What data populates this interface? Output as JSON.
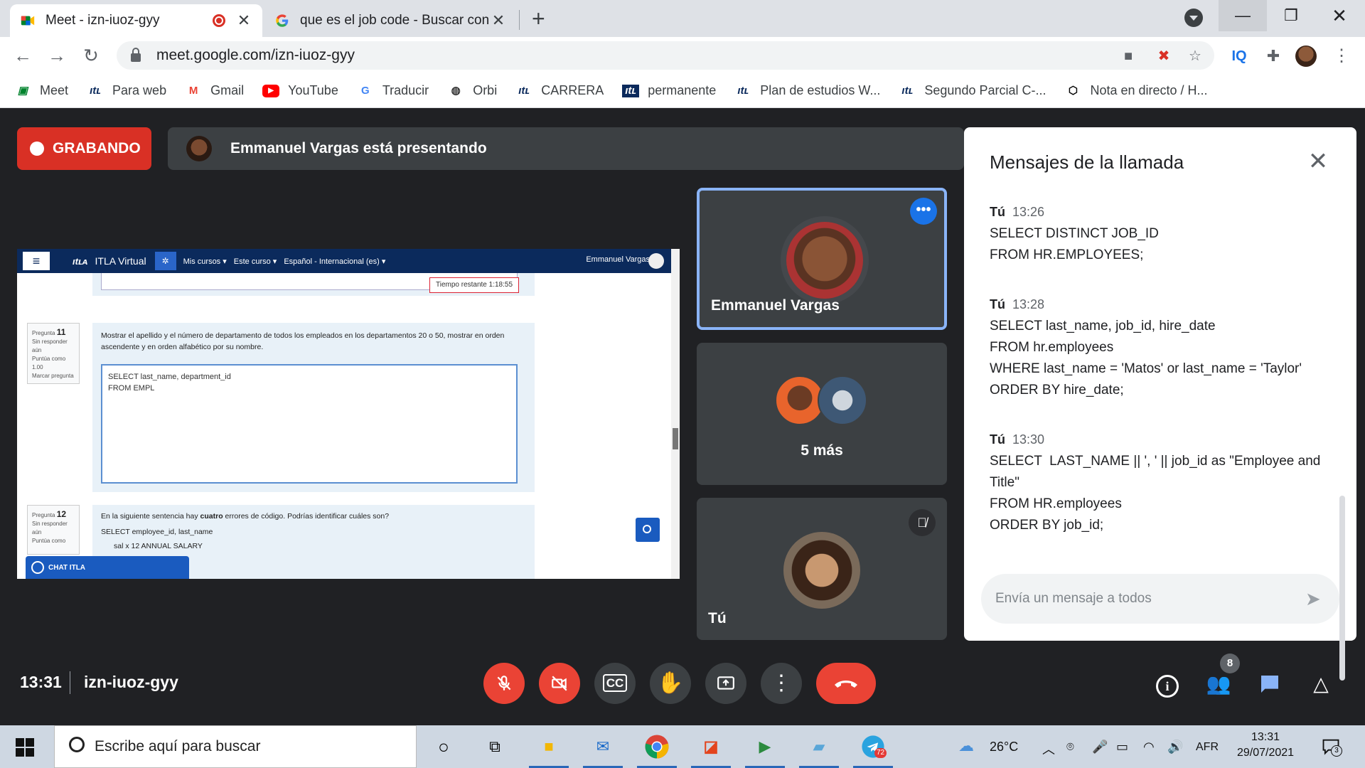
{
  "browser": {
    "tabs": [
      {
        "title": "Meet - izn-iuoz-gyy",
        "active": true
      },
      {
        "title": "que es el job code - Buscar con Google",
        "active": false
      }
    ],
    "url": "meet.google.com/izn-iuoz-gyy",
    "bookmarks": [
      {
        "label": "Meet",
        "icon": "meet-icon"
      },
      {
        "label": "Para web",
        "icon": "itla-icon"
      },
      {
        "label": "Gmail",
        "icon": "gmail-icon"
      },
      {
        "label": "YouTube",
        "icon": "youtube-icon"
      },
      {
        "label": "Traducir",
        "icon": "translate-icon"
      },
      {
        "label": "Orbi",
        "icon": "orbi-icon"
      },
      {
        "label": "CARRERA",
        "icon": "itla-icon"
      },
      {
        "label": "permanente",
        "icon": "itla-icon"
      },
      {
        "label": "Plan de estudios W...",
        "icon": "itla-icon"
      },
      {
        "label": "Segundo Parcial C-...",
        "icon": "itla-icon"
      },
      {
        "label": "Nota en directo / H...",
        "icon": "codepen-icon"
      }
    ]
  },
  "meet": {
    "recording_label": "GRABANDO",
    "presenting_text": "Emmanuel Vargas está presentando",
    "clock": "13:31",
    "meeting_code": "izn-iuoz-gyy",
    "participants_count": "8",
    "tiles": [
      {
        "name": "Emmanuel Vargas"
      },
      {
        "name": "5 más"
      },
      {
        "name": "Tú"
      }
    ]
  },
  "shared_screen": {
    "site_name": "ITLA Virtual",
    "nav": [
      "Mis cursos ▾",
      "Este curso ▾",
      "Español - Internacional (es) ▾"
    ],
    "user": "Emmanuel Vargas",
    "timer": "Tiempo restante 1:18:55",
    "q11": {
      "label": "Pregunta",
      "number": "11",
      "status": "Sin responder aún",
      "score": "Puntúa como 1.00",
      "flag": "Marcar pregunta",
      "text": "Mostrar el apellido y el número de departamento de todos los empleados en los departamentos 20 o 50, mostrar en orden ascendente y en orden alfabético por su nombre.",
      "answer_line1": "SELECT last_name, department_id",
      "answer_line2": "FROM EMPL"
    },
    "q12": {
      "label": "Pregunta",
      "number": "12",
      "status": "Sin responder aún",
      "score": "Puntúa como",
      "text_pre": "En la siguiente sentencia hay ",
      "text_bold": "cuatro",
      "text_post": " errores de código. Podrías identificar cuáles son?",
      "code_line1": "SELECT    employee_id, last_name",
      "code_line2": "sal x 12  ANNUAL SALARY"
    },
    "chat_label": "CHAT ITLA"
  },
  "chat": {
    "title": "Mensajes de la llamada",
    "placeholder": "Envía un mensaje a todos",
    "messages": [
      {
        "sender": "Tú",
        "time": "13:26",
        "lines": [
          "SELECT DISTINCT JOB_ID",
          "FROM HR.EMPLOYEES;"
        ]
      },
      {
        "sender": "Tú",
        "time": "13:28",
        "lines": [
          "SELECT last_name, job_id, hire_date",
          "FROM hr.employees",
          "WHERE last_name = 'Matos' or last_name = 'Taylor'",
          "ORDER BY hire_date;"
        ]
      },
      {
        "sender": "Tú",
        "time": "13:30",
        "lines": [
          "SELECT  LAST_NAME || ', ' || job_id as \"Employee and",
          "Title\"",
          "FROM HR.employees",
          "ORDER BY job_id;"
        ]
      }
    ]
  },
  "taskbar": {
    "search_placeholder": "Escribe aquí para buscar",
    "weather": "26°C",
    "language": "AFR",
    "time": "13:31",
    "date": "29/07/2021",
    "notifications": "3",
    "telegram_badge": "72"
  },
  "colors": {
    "meet_bg": "#202124",
    "tile_bg": "#3c4043",
    "danger": "#ea4335",
    "accent": "#1a73e8",
    "speaking_border": "#8ab4f8",
    "itla_navy": "#0b2a5c"
  }
}
